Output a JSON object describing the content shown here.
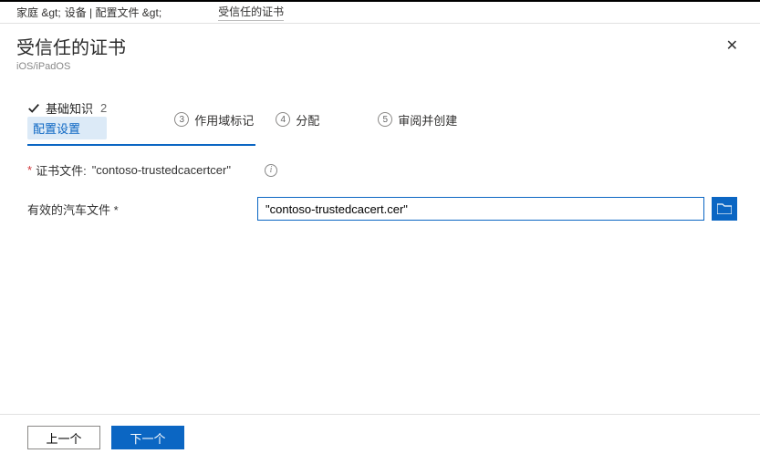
{
  "breadcrumbs": {
    "home": "家庭 &gt;",
    "devices": "设备 | 配置文件 &gt;",
    "current": "受信任的证书"
  },
  "header": {
    "title": "受信任的证书",
    "subtitle": "iOS/iPadOS"
  },
  "wizard": {
    "step1_label": "基础知识",
    "step1_suffix": "2",
    "step2_label": "配置设置",
    "step3_num": "3",
    "step3_label": "作用域标记",
    "step4_num": "4",
    "step4_label": "分配",
    "step5_num": "5",
    "step5_label": "审阅并创建"
  },
  "form": {
    "cert_file_label": "证书文件:",
    "cert_file_value": "\"contoso-trustedcacertcer\"",
    "valid_file_label": "有效的汽车文件 *",
    "input_value": "\"contoso-trustedcacert.cer\""
  },
  "footer": {
    "prev": "上一个",
    "next": "下一个"
  }
}
